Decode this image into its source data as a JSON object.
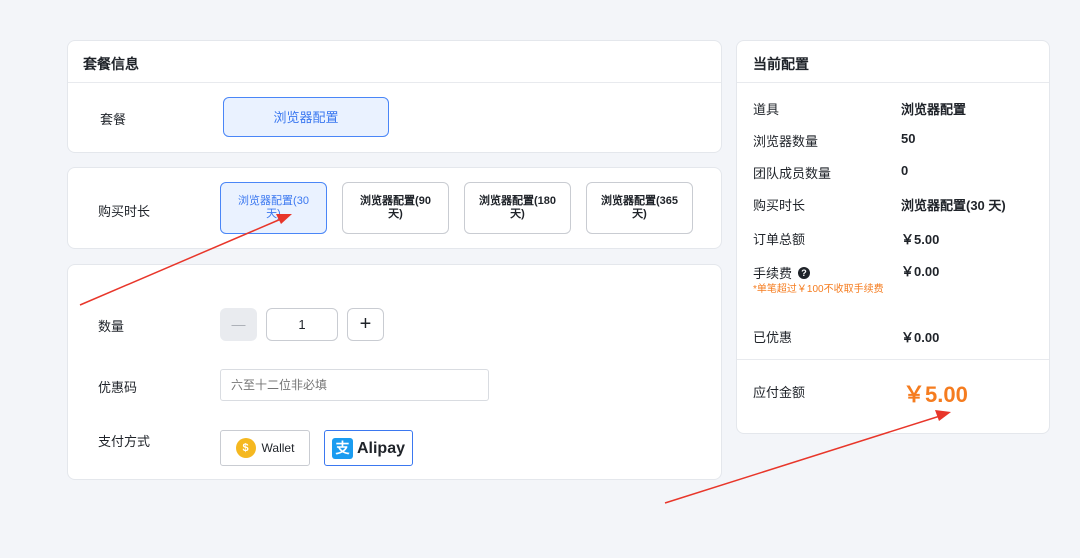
{
  "package_card": {
    "title": "套餐信息",
    "row_label": "套餐",
    "option": "浏览器配置"
  },
  "duration": {
    "label": "购买时长",
    "options": [
      {
        "line1": "浏览器配置(30",
        "line2": "天)"
      },
      {
        "line1": "浏览器配置(90",
        "line2": "天)"
      },
      {
        "line1": "浏览器配置(180",
        "line2": "天)"
      },
      {
        "line1": "浏览器配置(365",
        "line2": "天)"
      }
    ]
  },
  "form": {
    "quantity_label": "数量",
    "quantity_value": "1",
    "minus": "—",
    "plus": "+",
    "coupon_label": "优惠码",
    "coupon_placeholder": "六至十二位非必填",
    "payment_label": "支付方式",
    "wallet": "Wallet",
    "alipay": "Alipay",
    "alipay_mark": "支"
  },
  "summary": {
    "title": "当前配置",
    "rows": [
      {
        "label": "道具",
        "value": "浏览器配置"
      },
      {
        "label": "浏览器数量",
        "value": "50"
      },
      {
        "label": "团队成员数量",
        "value": "0"
      },
      {
        "label": "购买时长",
        "value": "浏览器配置(30 天)"
      },
      {
        "label": "订单总额",
        "value": "￥5.00"
      },
      {
        "label": "手续费",
        "value": "￥0.00"
      },
      {
        "label": "已优惠",
        "value": "￥0.00"
      }
    ],
    "fee_note": "*单笔超过￥100不收取手续费",
    "help_glyph": "?",
    "total_label": "应付金额",
    "total_value": "￥5.00"
  },
  "colors": {
    "accent": "#3b78f0",
    "price": "#f57c1f",
    "arrow": "#e8362a"
  }
}
